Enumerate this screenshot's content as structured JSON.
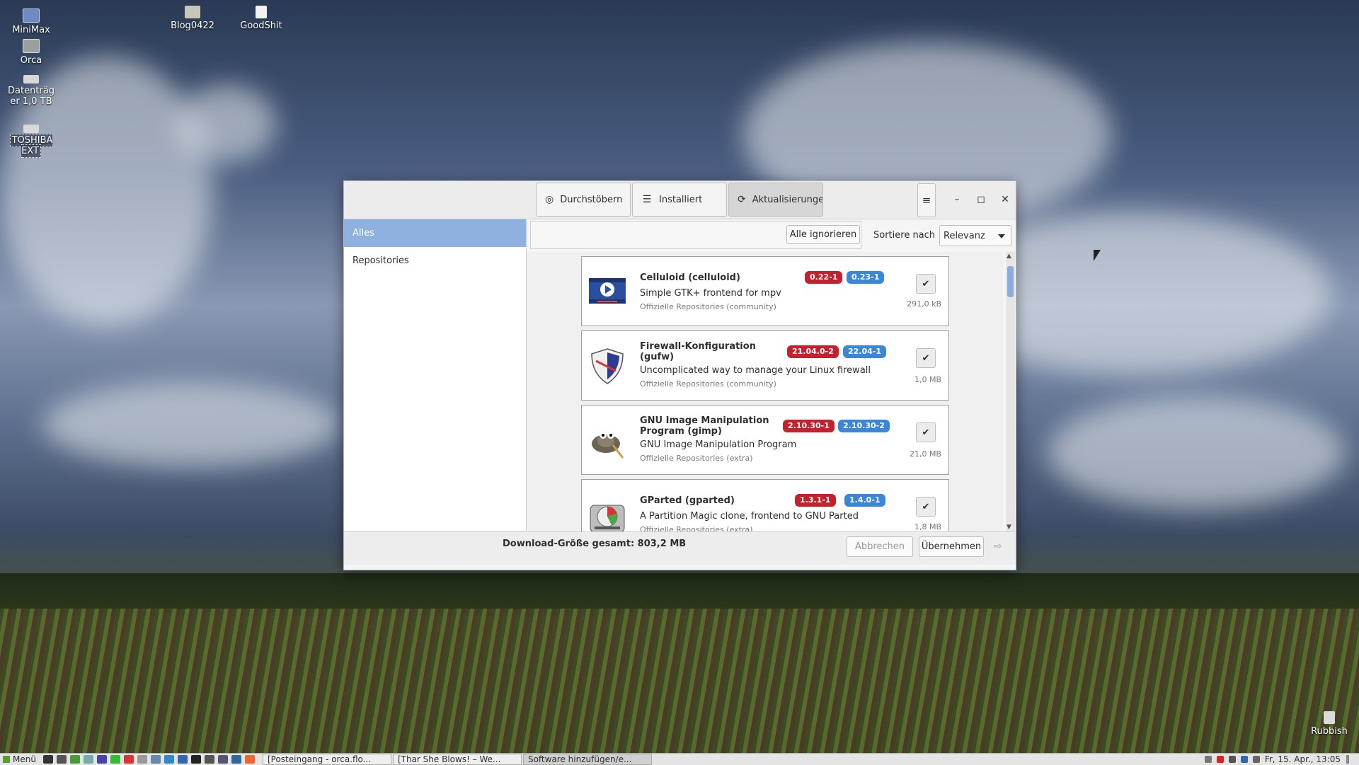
{
  "desktop": {
    "icons": [
      {
        "label": "MiniMax"
      },
      {
        "label": "Orca"
      },
      {
        "label": "Datenträg er 1,0 TB"
      },
      {
        "label": "TOSHIBA EXT"
      },
      {
        "label": "Blog0422"
      },
      {
        "label": "GoodShit"
      },
      {
        "label": "Rubbish"
      }
    ]
  },
  "window": {
    "tabs": [
      {
        "label": "Durchstöbern",
        "icon": "globe-icon"
      },
      {
        "label": "Installiert",
        "icon": "list-icon"
      },
      {
        "label": "Aktualisierungen",
        "icon": "update-icon"
      }
    ],
    "sidebar": {
      "items": [
        {
          "label": "Alles"
        },
        {
          "label": "Repositories"
        }
      ]
    },
    "toolbar": {
      "ignore_all_label": "Alle ignorieren",
      "sort_label": "Sortiere nach",
      "sort_value": "Relevanz"
    },
    "packages": [
      {
        "name": "Celluloid (celluloid)",
        "description": "Simple GTK+ frontend for mpv",
        "repository": "Offizielle Repositories (community)",
        "old_version": "0.22-1",
        "new_version": "0.23-1",
        "size": "291,0 kB",
        "icon": "celluloid-icon",
        "checked": true
      },
      {
        "name": "Firewall-Konfiguration (gufw)",
        "description": "Uncomplicated way to manage your Linux firewall",
        "repository": "Offizielle Repositories (community)",
        "old_version": "21.04.0-2",
        "new_version": "22.04-1",
        "size": "1,0 MB",
        "icon": "shield-icon",
        "checked": true
      },
      {
        "name": "GNU Image Manipulation Program (gimp)",
        "description": "GNU Image Manipulation Program",
        "repository": "Offizielle Repositories (extra)",
        "old_version": "2.10.30-1",
        "new_version": "2.10.30-2",
        "size": "21,0 MB",
        "icon": "gimp-icon",
        "checked": true
      },
      {
        "name": "GParted (gparted)",
        "description": "A Partition Magic clone, frontend to GNU Parted",
        "repository": "Offizielle Repositories (extra)",
        "old_version": "1.3.1-1",
        "new_version": "1.4.0-1",
        "size": "1,8 MB",
        "icon": "gparted-icon",
        "checked": true
      }
    ],
    "footer": {
      "download_size": "Download-Größe gesamt: 803,2 MB",
      "cancel_label": "Abbrechen",
      "apply_label": "Übernehmen"
    }
  },
  "taskbar": {
    "menu_label": "Menü",
    "tasks": [
      {
        "label": "[Posteingang - orca.flo..."
      },
      {
        "label": "[Thar She Blows! – We..."
      },
      {
        "label": "Software hinzufügen/e..."
      }
    ],
    "clock": "Fr, 15. Apr., 13:05"
  },
  "colors": {
    "selection_blue": "#8fb1e0",
    "old_version_red": "#c5202b",
    "new_version_blue": "#3a86d9"
  }
}
